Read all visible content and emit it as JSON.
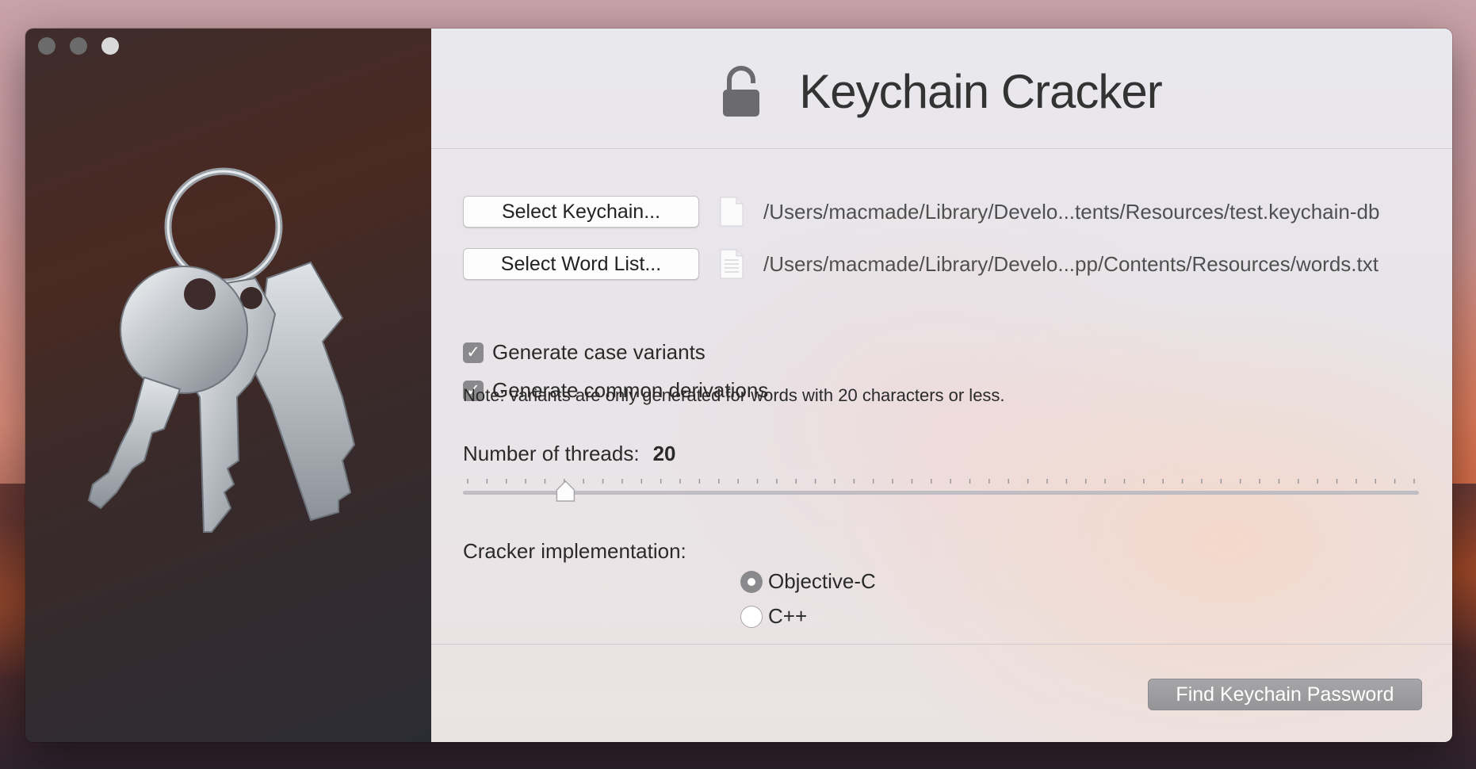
{
  "window": {
    "title": "Keychain Cracker"
  },
  "files": {
    "keychain_button": "Select Keychain...",
    "keychain_path": "/Users/macmade/Library/Develo...tents/Resources/test.keychain-db",
    "wordlist_button": "Select Word List...",
    "wordlist_path": "/Users/macmade/Library/Develo...pp/Contents/Resources/words.txt"
  },
  "options": {
    "case_variants_label": "Generate case variants",
    "case_variants_checked": true,
    "derivations_label": "Generate common derivations",
    "derivations_checked": true,
    "note": "Note: variants are only generated for words with 20 characters or less."
  },
  "threads": {
    "label": "Number of threads:",
    "value": "20",
    "slider_fraction": 0.1
  },
  "implementation": {
    "label": "Cracker implementation:",
    "options": [
      {
        "label": "Objective-C",
        "selected": true
      },
      {
        "label": "C++",
        "selected": false
      }
    ]
  },
  "actions": {
    "find_label": "Find Keychain Password"
  },
  "icons": {
    "lock": "unlocked-padlock-icon",
    "file": "document-icon",
    "app": "keychain-keys-icon"
  }
}
